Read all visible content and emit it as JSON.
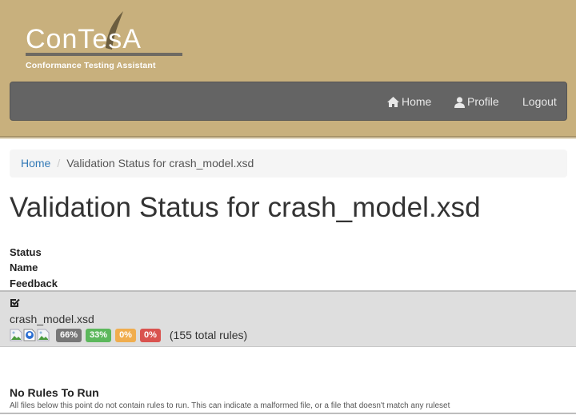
{
  "app": {
    "logo_title": "ConTesA",
    "logo_subtitle": "Conformance Testing Assistant"
  },
  "navbar": {
    "items": [
      {
        "label": "Home",
        "icon": "home-icon"
      },
      {
        "label": "Profile",
        "icon": "user-icon"
      },
      {
        "label": "Logout",
        "icon": null
      }
    ]
  },
  "breadcrumb": {
    "home": "Home",
    "separator": "/",
    "current": "Validation Status for crash_model.xsd"
  },
  "page": {
    "title": "Validation Status for crash_model.xsd"
  },
  "table": {
    "headers": [
      "Status",
      "Name",
      "Feedback"
    ],
    "rows": [
      {
        "status_icon": "checked-box-icon",
        "name": "crash_model.xsd",
        "feedback_icons": [
          "broken-image-icon",
          "globe-document-icon",
          "broken-image-icon"
        ],
        "badges": [
          {
            "label": "66%",
            "color": "#777777"
          },
          {
            "label": "33%",
            "color": "#5cb85c"
          },
          {
            "label": "0%",
            "color": "#f0ad4e"
          },
          {
            "label": "0%",
            "color": "#d9534f"
          }
        ],
        "total": "(155 total rules)"
      }
    ]
  },
  "no_rules": {
    "title": "No Rules To Run",
    "description": "All files below this point do not contain rules to run. This can indicate a malformed file, or a file that doesn't match any ruleset"
  }
}
